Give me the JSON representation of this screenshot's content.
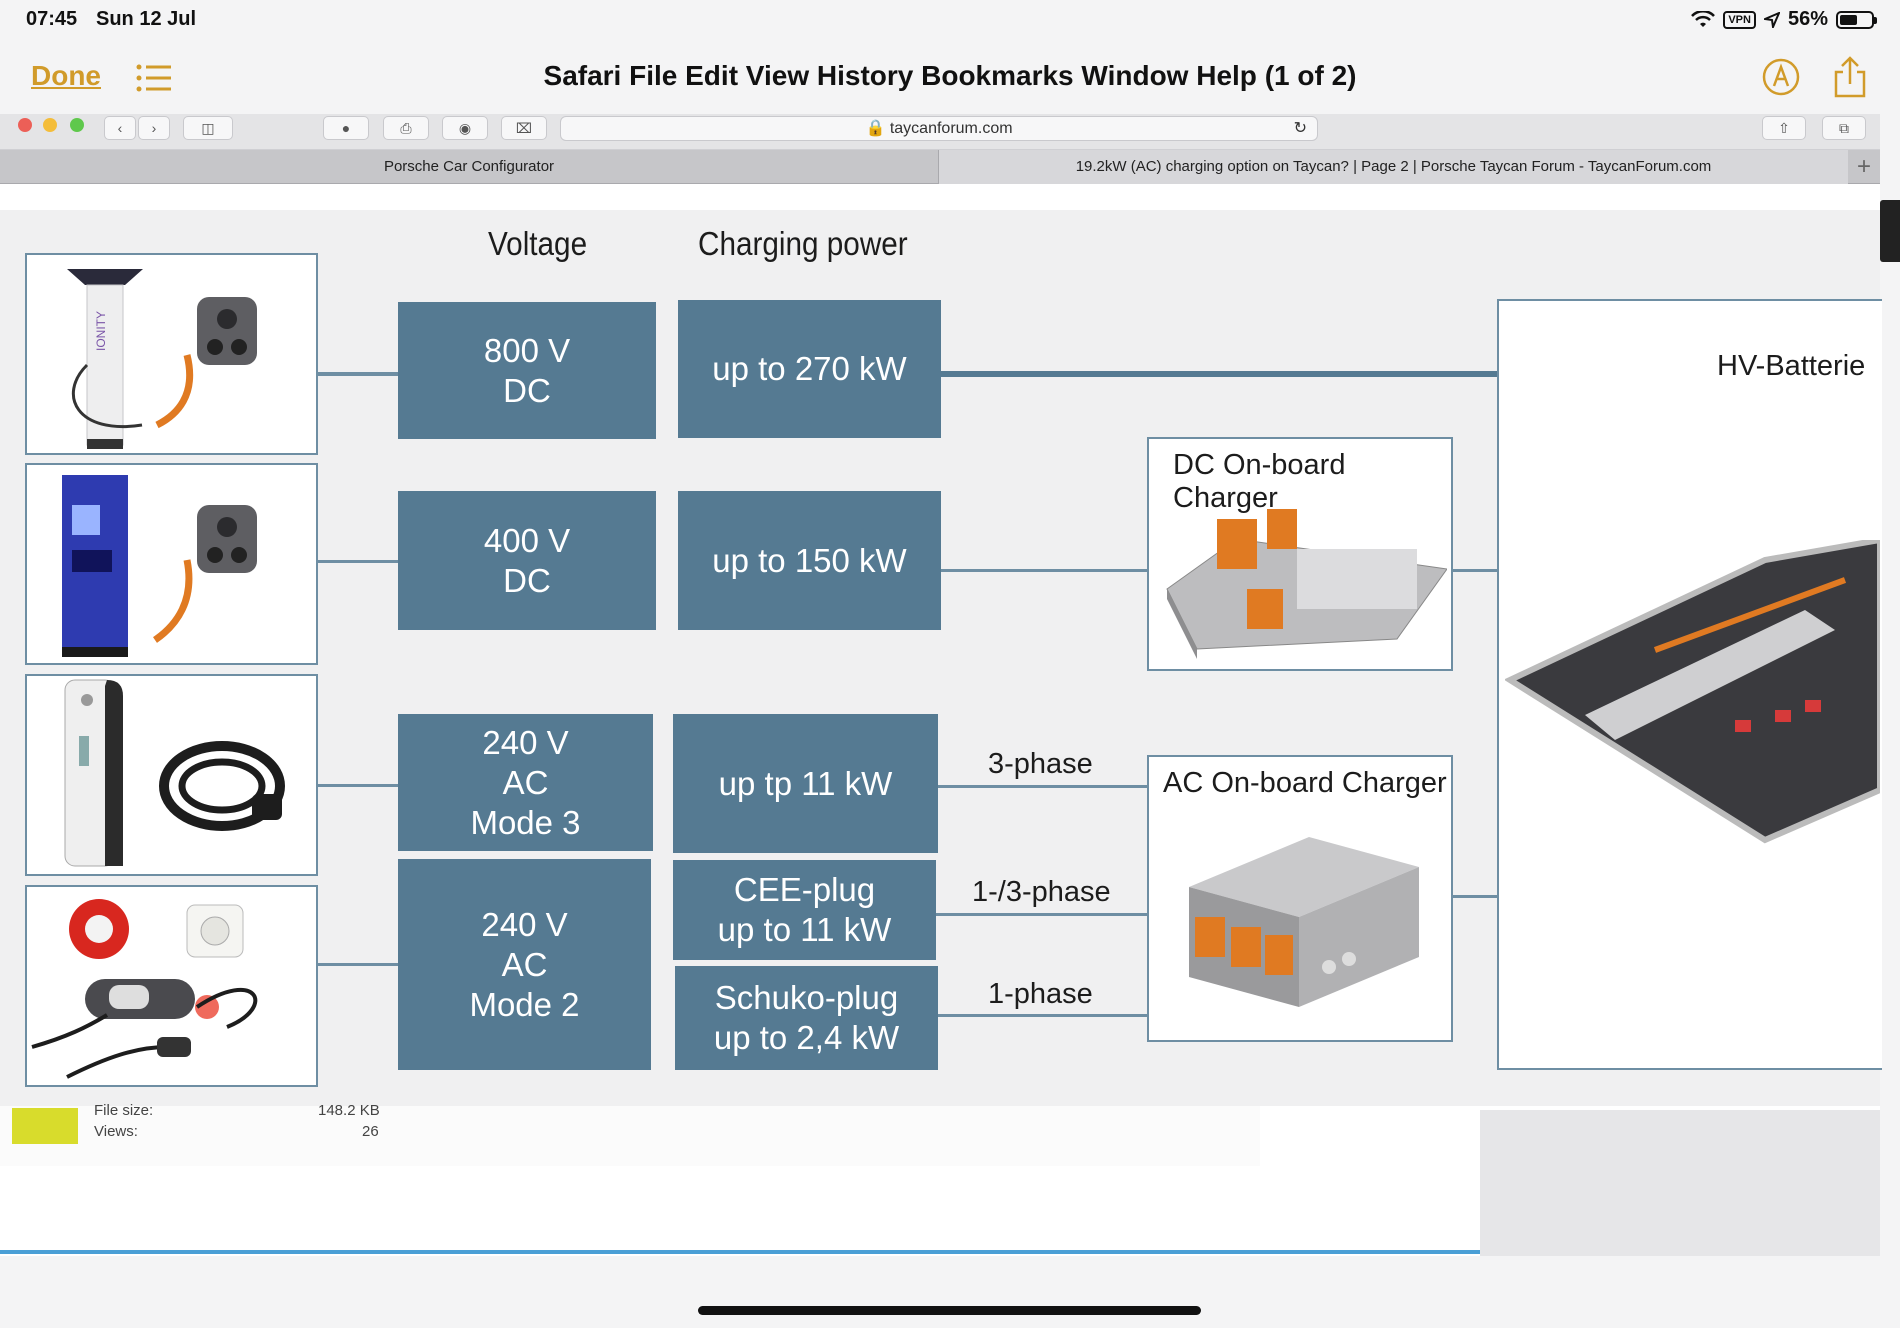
{
  "status_bar": {
    "time": "07:45",
    "date": "Sun 12 Jul",
    "vpn": "VPN",
    "battery": "56%",
    "battery_level": 0.56
  },
  "viewer": {
    "done_label": "Done",
    "title": "Safari File Edit View History Bookmarks Window Help (1 of 2)"
  },
  "browser": {
    "url": "taycanforum.com",
    "tabs": [
      {
        "label": "Porsche Car Configurator",
        "active": false
      },
      {
        "label": "19.2kW (AC) charging option on Taycan? | Page 2 | Porsche Taycan Forum - TaycanForum.com",
        "active": true
      }
    ],
    "new_tab_label": "+"
  },
  "diagram": {
    "headers": {
      "voltage": "Voltage",
      "power": "Charging power"
    },
    "voltage_boxes": [
      {
        "line1": "800 V",
        "line2": "DC",
        "line3": ""
      },
      {
        "line1": "400 V",
        "line2": "DC",
        "line3": ""
      },
      {
        "line1": "240 V",
        "line2": "AC",
        "line3": "Mode 3"
      },
      {
        "line1": "240 V",
        "line2": "AC",
        "line3": "Mode 2"
      }
    ],
    "power_boxes": [
      {
        "line1": "up to 270 kW",
        "line2": ""
      },
      {
        "line1": "up to 150 kW",
        "line2": ""
      },
      {
        "line1": "up tp 11 kW",
        "line2": ""
      },
      {
        "line1": "CEE-plug",
        "line2": "up to 11 kW"
      },
      {
        "line1": "Schuko-plug",
        "line2": "up to 2,4 kW"
      }
    ],
    "phases": [
      "3-phase",
      "1-/3-phase",
      "1-phase"
    ],
    "dc_charger_label": "DC On-board Charger",
    "ac_charger_label": "AC On-board Charger",
    "battery_label": "HV-Batterie",
    "ionity_text": "IONITY",
    "colors": {
      "box": "#557a92",
      "line": "#6e8ea3",
      "orange": "#e07a22"
    }
  },
  "attachment": {
    "file_size_label": "File size:",
    "file_size_value": "148.2 KB",
    "views_label": "Views:",
    "views_value": "26"
  }
}
